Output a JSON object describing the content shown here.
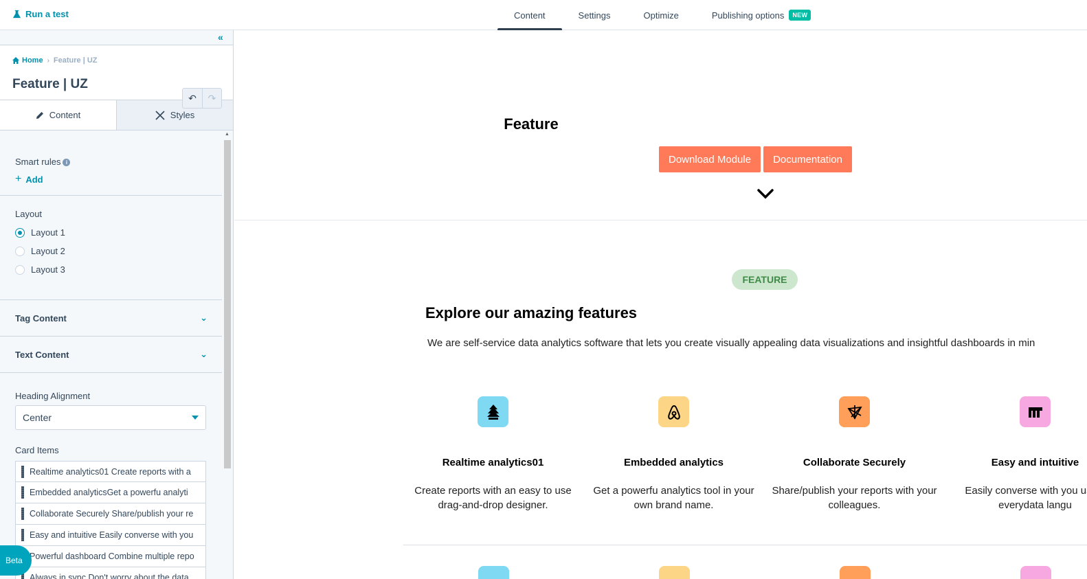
{
  "topbar": {
    "run_test": "Run a test",
    "tabs": [
      {
        "label": "Content"
      },
      {
        "label": "Settings"
      },
      {
        "label": "Optimize"
      },
      {
        "label": "Publishing options",
        "badge": "NEW"
      }
    ]
  },
  "sidebar": {
    "breadcrumb": {
      "home": "Home",
      "current": "Feature | UZ"
    },
    "title": "Feature | UZ",
    "tabs": [
      {
        "label": "Content"
      },
      {
        "label": "Styles"
      }
    ],
    "smart_rules": {
      "label": "Smart rules",
      "add": "Add"
    },
    "layout": {
      "label": "Layout",
      "options": [
        "Layout 1",
        "Layout 2",
        "Layout 3"
      ],
      "selected": "Layout 1"
    },
    "accordions": [
      "Tag Content",
      "Text Content"
    ],
    "heading_alignment": {
      "label": "Heading Alignment",
      "value": "Center"
    },
    "card_items": {
      "label": "Card Items",
      "items": [
        "Realtime analytics01 Create reports with a",
        "Embedded analyticsGet a powerfu analyti",
        "Collaborate Securely Share/publish your re",
        "Easy and intuitive Easily converse with you",
        "Powerful dashboard Combine multiple repo",
        "Always in sync Don't worry about the data"
      ]
    },
    "beta": "Beta"
  },
  "preview": {
    "hero": {
      "title": "Feature",
      "buttons": [
        "Download Module",
        "Documentation"
      ]
    },
    "features": {
      "pill": "FEATURE",
      "heading": "Explore our amazing features",
      "subtitle": "We are self-service data analytics software that lets you create visually appealing data visualizations and insightful dashboards in min",
      "cards": [
        {
          "title": "Realtime analytics01",
          "desc": "Create reports with an easy to use drag-and-drop designer.",
          "icon": "tree-icon",
          "color": "#7fd9f2"
        },
        {
          "title": "Embedded analytics",
          "desc": "Get a powerfu analytics tool in your own brand name.",
          "icon": "airbnb-icon",
          "color": "#fdd586"
        },
        {
          "title": "Collaborate Securely",
          "desc": "Share/publish your reports with your colleagues.",
          "icon": "network-icon",
          "color": "#ff9f5a"
        },
        {
          "title": "Easy and intuitive",
          "desc": "Easily converse with you using everydata langu",
          "icon": "monday-icon",
          "color": "#f7a8e0"
        }
      ]
    }
  },
  "colors": {
    "accent": "#0091ae",
    "cta": "#ff7a59",
    "badge_new": "#00bda5",
    "pill_bg": "#cde7cf",
    "pill_text": "#3f8a46"
  }
}
